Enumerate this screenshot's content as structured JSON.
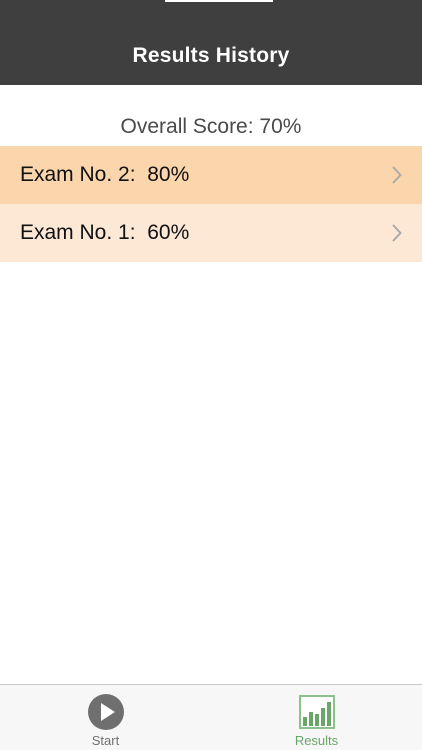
{
  "navbar": {
    "title": "Results History"
  },
  "summary": {
    "overall_score": "Overall Score: 70%"
  },
  "results": [
    {
      "label": "Exam No. 2:  80%",
      "icon": "chevron-right-icon"
    },
    {
      "label": "Exam No. 1:  60%",
      "icon": "chevron-right-icon"
    }
  ],
  "tabbar": {
    "tabs": [
      {
        "label": "Start",
        "icon": "play-circle-icon",
        "selected": false
      },
      {
        "label": "Results",
        "icon": "bar-chart-icon",
        "selected": true
      }
    ]
  },
  "colors": {
    "navbar": "#3f3f3f",
    "row_highlight": "#fbd6ad",
    "row_light": "#fde8d6",
    "tab_selected": "#6aa66a",
    "tab_unselected": "#6f6f6f"
  }
}
